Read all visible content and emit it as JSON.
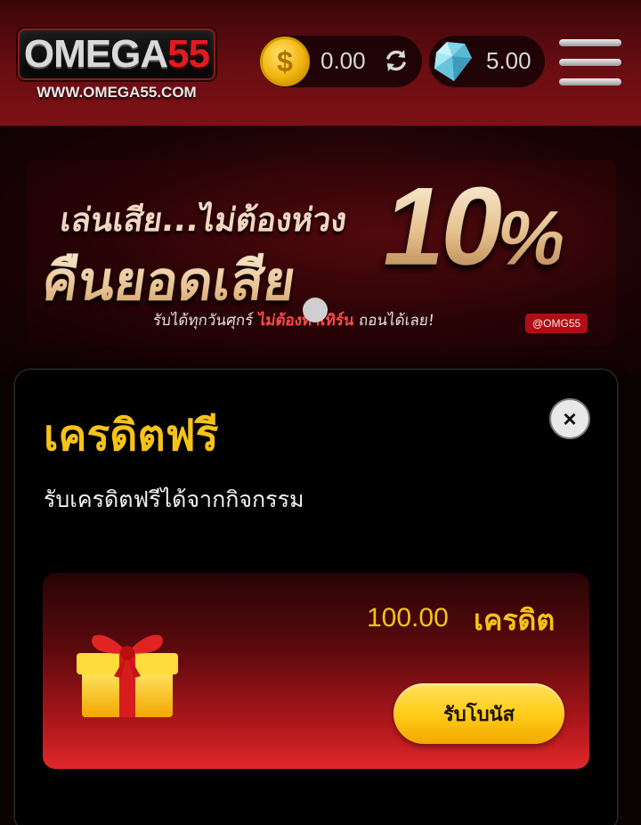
{
  "header": {
    "logo_text_1": "OMEGA",
    "logo_text_2": "55",
    "logo_url": "WWW.OMEGA55.COM",
    "coin_balance": "0.00",
    "gem_balance": "5.00",
    "icons": [
      "coin-icon",
      "refresh-icon",
      "diamond-icon",
      "hamburger-menu-icon"
    ]
  },
  "banner": {
    "line1": "เล่นเสีย...ไม่ต้องห่วง",
    "line2": "คืนยอดเสีย",
    "big": "10",
    "pct": "%",
    "sub_prefix": "รับได้ทุกวันศุกร์ ",
    "sub_highlight": "ไม่ต้องทำเทิร์น",
    "sub_suffix": " ถอนได้เลย!",
    "line_id": "@OMG55"
  },
  "modal": {
    "title": "เครดิตฟรี",
    "subtitle": "รับเครดิตฟรีได้จากกิจกรรม",
    "close_symbol": "×",
    "card": {
      "amount": "100.00",
      "unit": "เครดิต",
      "button_label": "รับโบนัส"
    }
  },
  "colors": {
    "accent_gold": "#f6c21a",
    "header_red": "#6a0d12",
    "card_red": "#e0282b",
    "brand_red": "#e11b22"
  }
}
